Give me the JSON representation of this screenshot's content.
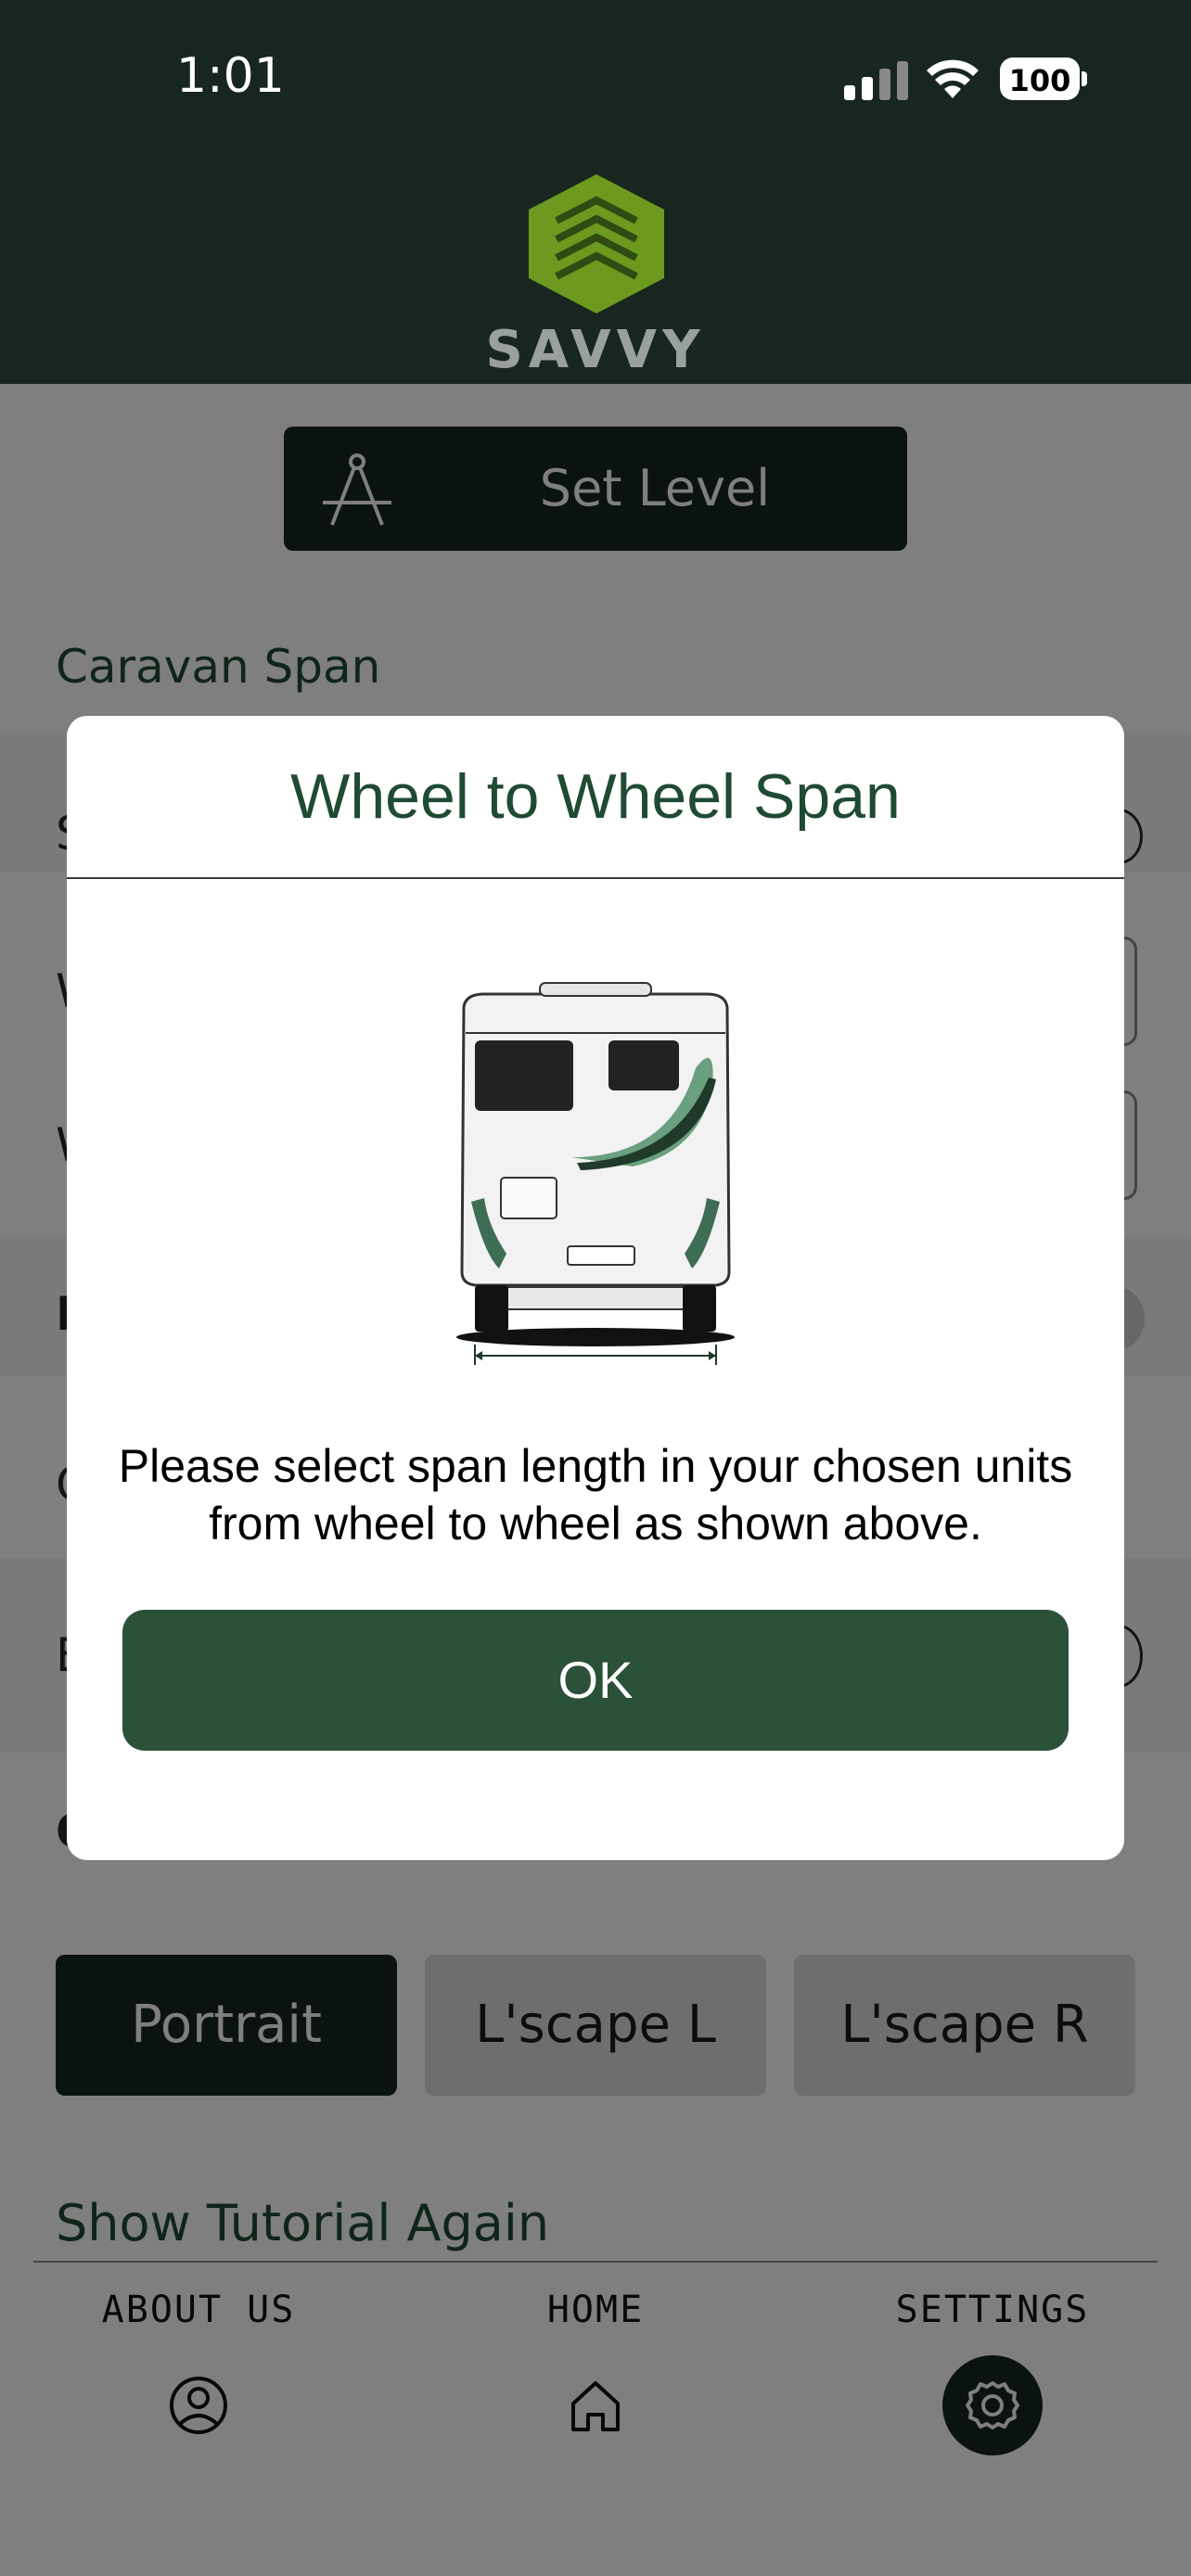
{
  "status_bar": {
    "time": "1:01",
    "battery": "100"
  },
  "header": {
    "brand": "SAVVY"
  },
  "set_level": {
    "label": "Set Level"
  },
  "sections": {
    "caravan_span": "Caravan Span",
    "show_tutorial": "Show Tutorial Again"
  },
  "ghost_letters": [
    "S",
    "W",
    "W",
    "I",
    "C",
    "E",
    "O"
  ],
  "orientation": {
    "portrait": "Portrait",
    "landscape_left": "L'scape L",
    "landscape_right": "L'scape R"
  },
  "nav": {
    "about": "ABOUT US",
    "home": "HOME",
    "settings": "SETTINGS"
  },
  "dialog": {
    "title": "Wheel to Wheel Span",
    "message": "Please select span length in your chosen units from wheel to wheel as shown above.",
    "ok": "OK"
  }
}
